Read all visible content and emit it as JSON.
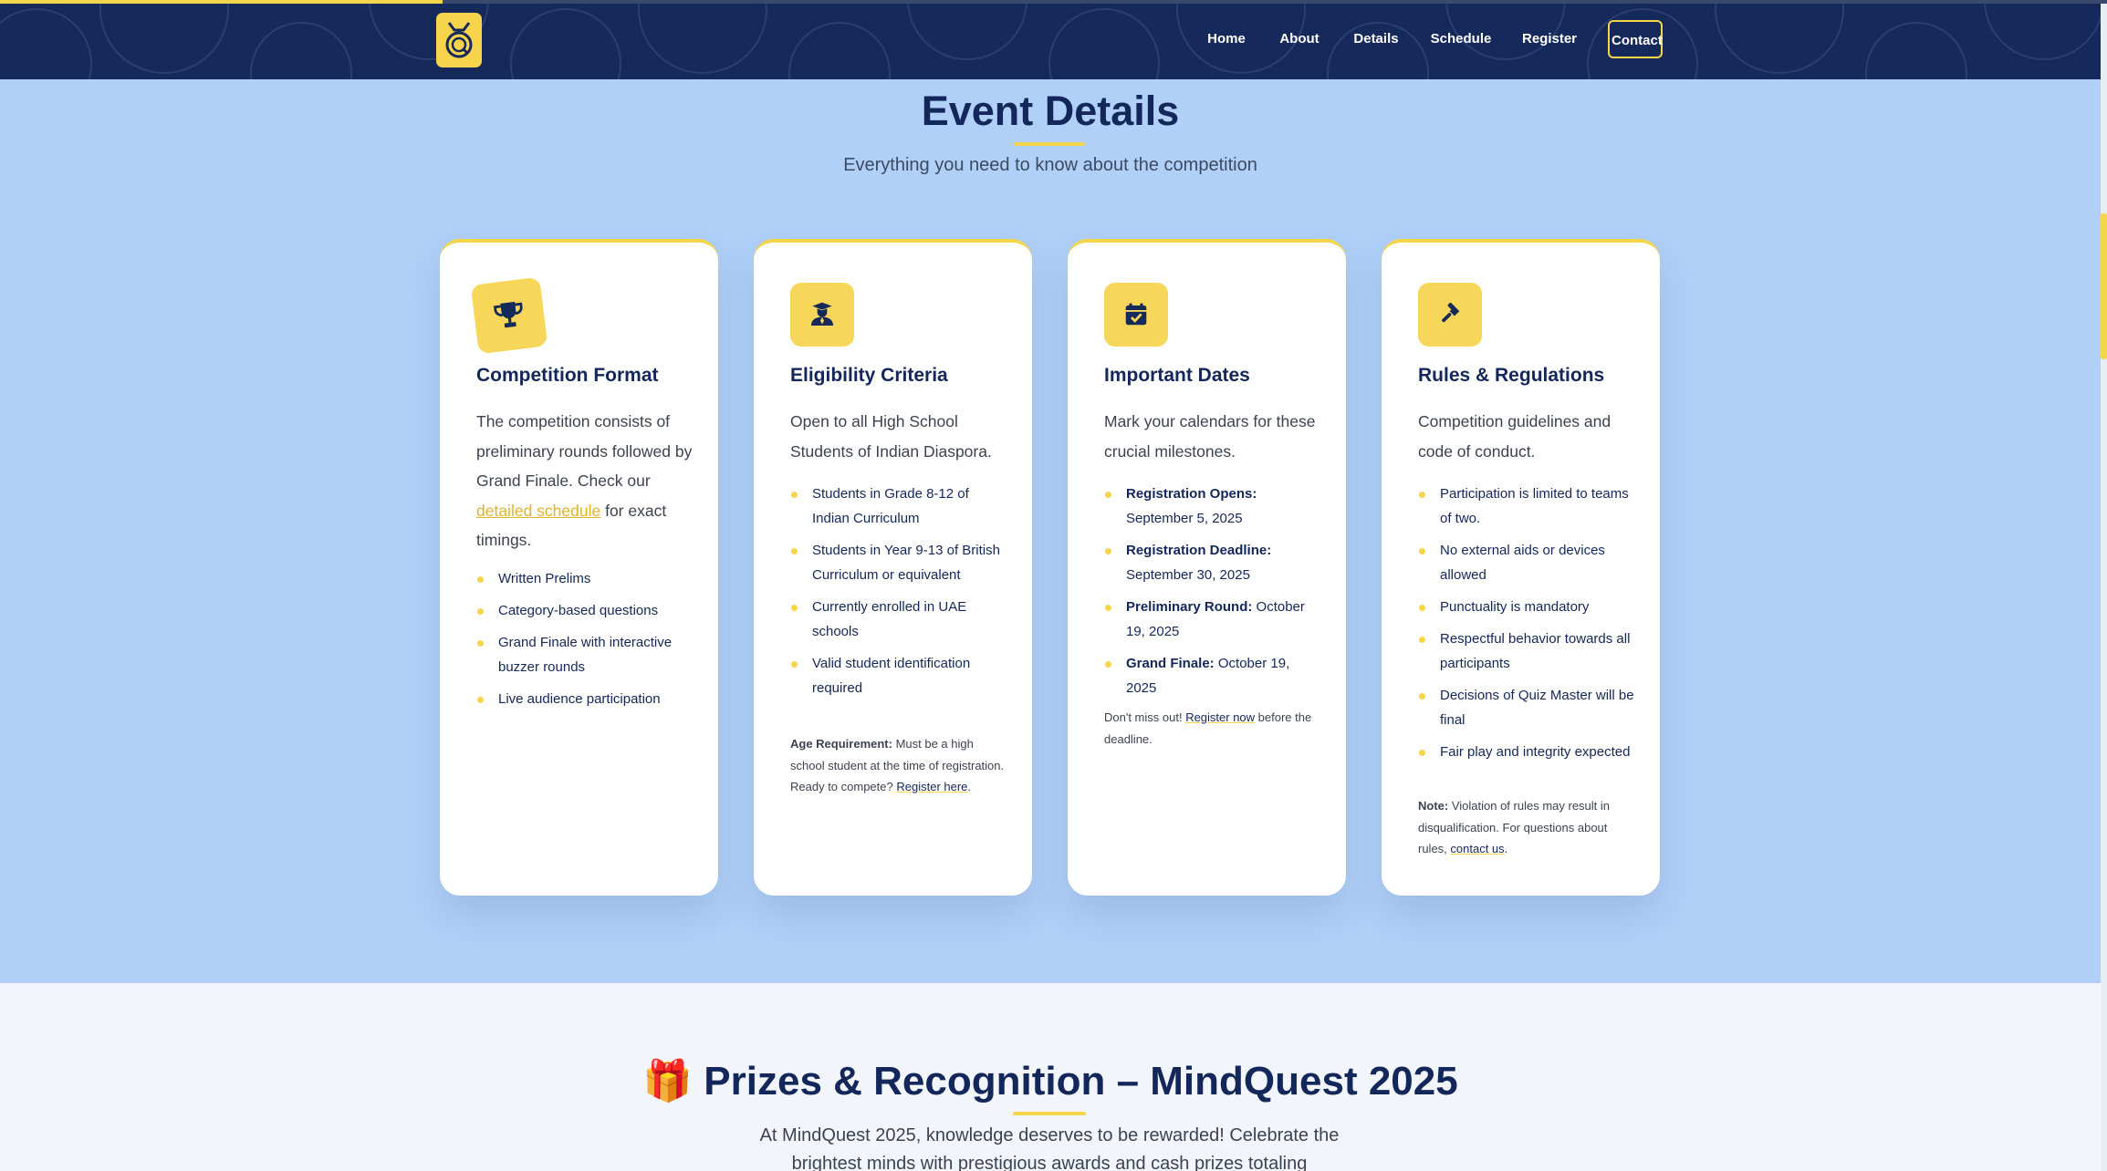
{
  "progress": {
    "fraction": 0.21
  },
  "colors": {
    "nav_bg": "#15295a",
    "accent": "#f5d54a",
    "section_bg": "#b0d0f8",
    "heading": "#13275a"
  },
  "header": {
    "logo_icon": "quiz-badge-logo",
    "nav": [
      "Home",
      "About",
      "Details",
      "Schedule",
      "Register",
      "Contact"
    ]
  },
  "details": {
    "title": "Event Details",
    "subtitle": "Everything you need to know about the competition",
    "cards": [
      {
        "icon": "trophy-icon",
        "title": "Competition Format",
        "desc_before": "The competition consists of preliminary rounds followed by Grand Finale. Check our ",
        "desc_link": "detailed schedule",
        "desc_after": " for exact timings.",
        "bullets": [
          "Written Prelims",
          "Category-based questions",
          "Grand Finale with interactive buzzer rounds",
          "Live audience participation"
        ]
      },
      {
        "icon": "graduate-icon",
        "title": "Eligibility Criteria",
        "desc": "Open to all High School Students of Indian Diaspora.",
        "bullets": [
          "Students in Grade 8-12 of Indian Curriculum",
          "Students in Year 9-13 of British Curriculum or equivalent",
          "Currently enrolled in UAE schools",
          "Valid student identification required"
        ],
        "note_bold": "Age Requirement:",
        "note_text": " Must be a high school student at the time of registration. Ready to compete? ",
        "note_link": "Register here",
        "note_end": "."
      },
      {
        "icon": "calendar-check-icon",
        "title": "Important Dates",
        "desc": "Mark your calendars for these crucial milestones.",
        "dates": [
          {
            "label": "Registration Opens:",
            "value": "September 5, 2025"
          },
          {
            "label": "Registration Deadline:",
            "value": "September 30, 2025"
          },
          {
            "label": "Preliminary Round:",
            "value": "October 19, 2025"
          },
          {
            "label": "Grand Finale:",
            "value": "October 19, 2025"
          }
        ],
        "note_text": "Don't miss out! ",
        "note_link": "Register now",
        "note_end": " before the deadline."
      },
      {
        "icon": "gavel-icon",
        "title": "Rules & Regulations",
        "desc": "Competition guidelines and code of conduct.",
        "bullets": [
          "Participation is limited to teams of two.",
          "No external aids or devices allowed",
          "Punctuality is mandatory",
          "Respectful behavior towards all participants",
          "Decisions of Quiz Master will be final",
          "Fair play and integrity expected"
        ],
        "note_bold": "Note:",
        "note_text": " Violation of rules may result in disqualification. For questions about rules, ",
        "note_link": "contact us",
        "note_end": "."
      }
    ]
  },
  "prizes": {
    "emoji": "🎁",
    "title": "Prizes & Recognition – MindQuest 2025",
    "text": "At MindQuest 2025, knowledge deserves to be rewarded! Celebrate the brightest minds with prestigious awards and cash prizes totaling"
  }
}
